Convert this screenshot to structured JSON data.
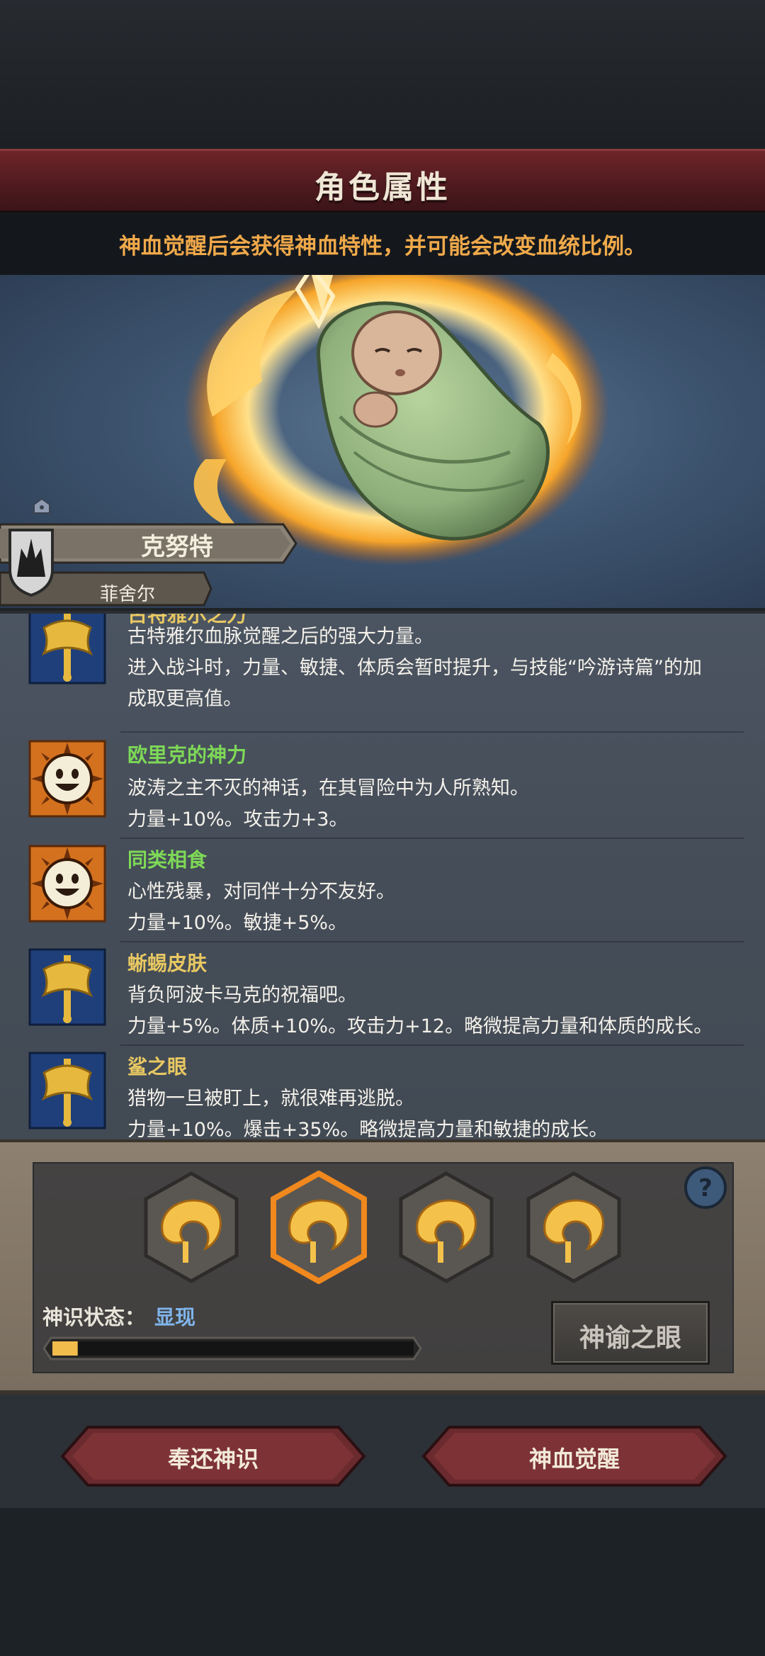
{
  "header": {
    "title": "角色属性",
    "hint": "神血觉醒后会获得神血特性，并可能会改变血统比例。"
  },
  "character": {
    "name": "克努特",
    "house": "菲舍尔"
  },
  "traits": [
    {
      "icon": "axe-icon",
      "name": "古特雅尔之力",
      "name_color": "#e8c862",
      "lines": [
        "古特雅尔血脉觉醒之后的强大力量。",
        "进入战斗时，力量、敏捷、体质会暂时提升，与技能“吟游诗篇”的加",
        "成取更高值。"
      ]
    },
    {
      "icon": "smiley-sun-icon",
      "name": "欧里克的神力",
      "name_color": "#7ed957",
      "lines": [
        "波涛之主不灭的神话，在其冒险中为人所熟知。",
        "力量+10%。攻击力+3。"
      ]
    },
    {
      "icon": "smiley-sun-icon",
      "name": "同类相食",
      "name_color": "#7ed957",
      "lines": [
        "心性残暴，对同伴十分不友好。",
        "力量+10%。敏捷+5%。"
      ]
    },
    {
      "icon": "axe-icon",
      "name": "蜥蜴皮肤",
      "name_color": "#e8c862",
      "lines": [
        "背负阿波卡马克的祝福吧。",
        "力量+5%。体质+10%。攻击力+12。略微提高力量和体质的成长。"
      ]
    },
    {
      "icon": "axe-icon",
      "name": "鲨之眼",
      "name_color": "#e8c862",
      "lines": [
        "猎物一旦被盯上，就很难再逃脱。",
        "力量+10%。爆击+35%。略微提高力量和敏捷的成长。"
      ]
    }
  ],
  "divine": {
    "selected_index": 1,
    "slots": [
      "flame-horn-icon",
      "flame-horn-icon",
      "flame-horn-icon",
      "flame-horn-icon"
    ],
    "status_label": "神识状态：",
    "status_value": "显现",
    "progress": 0.07,
    "oracle_button": "神谕之眼",
    "help_icon": "question-icon"
  },
  "actions": {
    "return_label": "奉还神识",
    "awaken_label": "神血觉醒"
  },
  "colors": {
    "accent_red": "#6e2529",
    "hint_orange": "#f0a94a",
    "status_blue": "#7fb4ea",
    "progress_fill": "#f2bc4c"
  }
}
